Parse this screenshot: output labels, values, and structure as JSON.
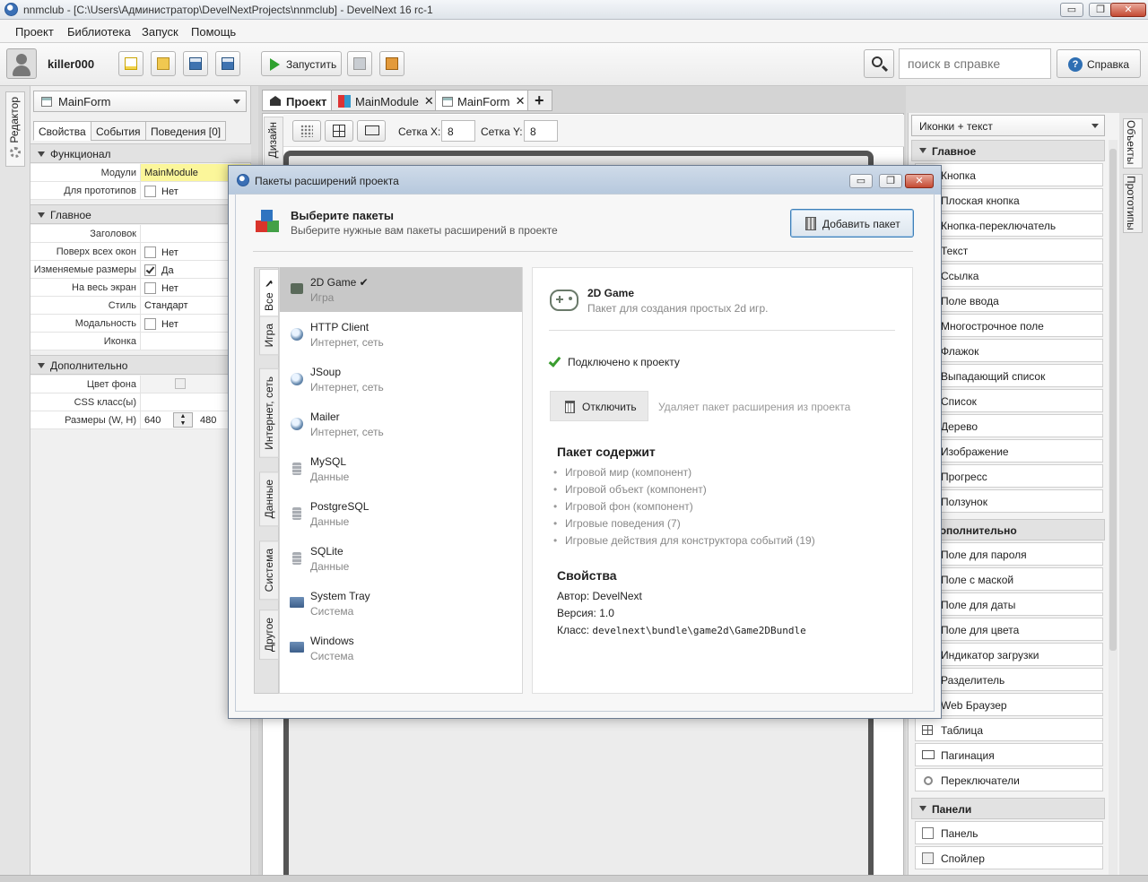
{
  "window": {
    "title": "nnmclub - [C:\\Users\\Администратор\\DevelNextProjects\\nnmclub] - DevelNext 16 rc-1",
    "min": "▭",
    "max": "❐",
    "close": "✕"
  },
  "menu": [
    "Проект",
    "Библиотека",
    "Запуск",
    "Помощь"
  ],
  "toolbar": {
    "user": "killer000",
    "run_label": "Запустить",
    "search_placeholder": "поиск в справке",
    "help_label": "Справка"
  },
  "left_strip": {
    "editor_tab": "Редактор"
  },
  "left_panel": {
    "form_combo": "MainForm",
    "tabs": [
      "Свойства",
      "События",
      "Поведения [0]"
    ],
    "sections": {
      "func": "Функционал",
      "main": "Главное",
      "extra": "Дополнительно"
    },
    "func_rows": [
      {
        "k": "Модули",
        "v": "MainModule"
      },
      {
        "k": "Для прототипов",
        "v": "Нет"
      }
    ],
    "main_rows": [
      {
        "k": "Заголовок",
        "v": ""
      },
      {
        "k": "Поверх всех окон",
        "v": "Нет"
      },
      {
        "k": "Изменяемые размеры",
        "v": "Да"
      },
      {
        "k": "На весь экран",
        "v": "Нет"
      },
      {
        "k": "Стиль",
        "v": "Стандарт"
      },
      {
        "k": "Модальность",
        "v": "Нет"
      },
      {
        "k": "Иконка",
        "v": ""
      }
    ],
    "extra_rows": [
      {
        "k": "Цвет фона",
        "v": ""
      },
      {
        "k": "CSS класс(ы)",
        "v": ""
      },
      {
        "k": "Размеры (W, H)",
        "w": "640",
        "h": "480"
      }
    ]
  },
  "doc_tabs": [
    "Проект",
    "MainModule",
    "MainForm"
  ],
  "designer": {
    "vtab": "Дизайн",
    "grid_x_label": "Сетка X:",
    "grid_x": "8",
    "grid_y_label": "Сетка Y:",
    "grid_y": "8"
  },
  "right_panel": {
    "combo": "Иконки + текст",
    "sections": [
      "Главное",
      "Дополнительно",
      "Панели"
    ],
    "main_items": [
      "Кнопка",
      "Плоская кнопка",
      "Кнопка-переключатель",
      "Текст",
      "Ссылка",
      "Поле ввода",
      "Многострочное поле",
      "Флажок",
      "Выпадающий список",
      "Список",
      "Дерево",
      "Изображение",
      "Прогресс",
      "Ползунок"
    ],
    "extra_items": [
      "Поле для пароля",
      "Поле с маской",
      "Поле для даты",
      "Поле для цвета",
      "Индикатор загрузки",
      "Разделитель",
      "Web Браузер",
      "Таблица",
      "Пагинация",
      "Переключатели"
    ],
    "panel_items": [
      "Панель",
      "Спойлер"
    ],
    "vtabs": [
      "Объекты",
      "Прототипы"
    ]
  },
  "dialog": {
    "title": "Пакеты расширений проекта",
    "header_title": "Выберите пакеты",
    "header_sub": "Выберите нужные вам пакеты расширений в проекте",
    "add_button": "Добавить пакет",
    "categories": [
      "Все",
      "Игра",
      "Интернет, сеть",
      "Данные",
      "Система",
      "Другое"
    ],
    "packages": [
      {
        "name": "2D Game ✔",
        "cat": "Игра",
        "icon": "game"
      },
      {
        "name": "HTTP Client",
        "cat": "Интернет, сеть",
        "icon": "net"
      },
      {
        "name": "JSoup",
        "cat": "Интернет, сеть",
        "icon": "net"
      },
      {
        "name": "Mailer",
        "cat": "Интернет, сеть",
        "icon": "net"
      },
      {
        "name": "MySQL",
        "cat": "Данные",
        "icon": "db"
      },
      {
        "name": "PostgreSQL",
        "cat": "Данные",
        "icon": "db"
      },
      {
        "name": "SQLite",
        "cat": "Данные",
        "icon": "db"
      },
      {
        "name": "System Tray",
        "cat": "Система",
        "icon": "sys"
      },
      {
        "name": "Windows",
        "cat": "Система",
        "icon": "sys"
      }
    ],
    "detail": {
      "name": "2D Game",
      "desc": "Пакет для создания простых 2d игр.",
      "status": "Подключено к проекту",
      "disable_button": "Отключить",
      "disable_hint": "Удаляет пакет расширения из проекта",
      "contains_title": "Пакет содержит",
      "contains": [
        "Игровой мир (компонент)",
        "Игровой объект (компонент)",
        "Игровой фон (компонент)",
        "Игровые поведения (7)",
        "Игровые действия для конструктора событий (19)"
      ],
      "props_title": "Свойства",
      "author_label": "Автор:",
      "author": "DevelNext",
      "version_label": "Версия:",
      "version": "1.0",
      "class_label": "Класс:",
      "class": "develnext\\bundle\\game2d\\Game2DBundle"
    }
  }
}
